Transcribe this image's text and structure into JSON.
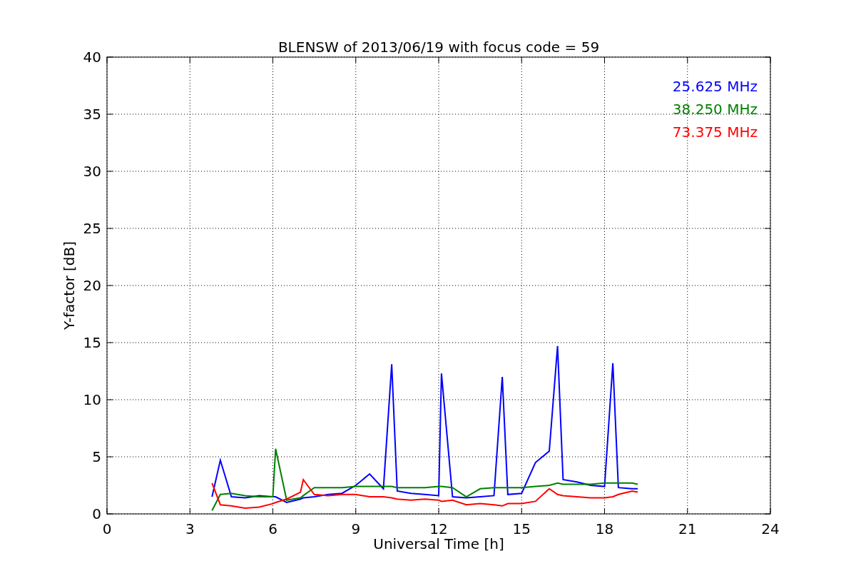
{
  "chart_data": {
    "type": "line",
    "title": "BLENSW of 2013/06/19 with focus code = 59",
    "xlabel": "Universal Time [h]",
    "ylabel": "Y-factor [dB]",
    "x": [
      3.8,
      4.1,
      4.5,
      5,
      5.5,
      6,
      6.1,
      6.5,
      7,
      7.1,
      7.5,
      8,
      8.5,
      9,
      9.5,
      10,
      10.3,
      10.5,
      11,
      11.5,
      12,
      12.1,
      12.5,
      13,
      13.5,
      14,
      14.3,
      14.5,
      15,
      15.5,
      16,
      16.3,
      16.5,
      17,
      17.5,
      18,
      18.3,
      18.5,
      19,
      19.2
    ],
    "series": [
      {
        "name": "25.625 MHz",
        "color": "#0000ff",
        "values": [
          1.5,
          4.7,
          1.5,
          1.4,
          1.6,
          1.5,
          1.5,
          1.0,
          1.3,
          1.4,
          1.5,
          1.7,
          1.8,
          2.5,
          3.5,
          2.2,
          13.1,
          2.0,
          1.8,
          1.7,
          1.6,
          12.3,
          1.5,
          1.4,
          1.5,
          1.6,
          12.0,
          1.7,
          1.8,
          4.5,
          5.5,
          14.7,
          3.0,
          2.8,
          2.5,
          2.4,
          13.2,
          2.3,
          2.2,
          2.2
        ]
      },
      {
        "name": "38.250 MHz",
        "color": "#008000",
        "values": [
          0.3,
          1.7,
          1.8,
          1.6,
          1.5,
          1.5,
          5.7,
          1.2,
          1.4,
          1.6,
          2.3,
          2.3,
          2.3,
          2.4,
          2.4,
          2.4,
          2.4,
          2.3,
          2.3,
          2.3,
          2.4,
          2.4,
          2.3,
          1.5,
          2.2,
          2.3,
          2.3,
          2.3,
          2.3,
          2.4,
          2.5,
          2.7,
          2.6,
          2.6,
          2.6,
          2.7,
          2.7,
          2.7,
          2.7,
          2.6
        ]
      },
      {
        "name": "73.375 MHz",
        "color": "#ff0000",
        "values": [
          2.7,
          0.8,
          0.7,
          0.5,
          0.6,
          0.9,
          1.0,
          1.3,
          1.9,
          3.0,
          1.7,
          1.6,
          1.7,
          1.7,
          1.5,
          1.5,
          1.4,
          1.3,
          1.2,
          1.3,
          1.2,
          1.1,
          1.2,
          0.8,
          0.9,
          0.8,
          0.7,
          0.9,
          0.9,
          1.1,
          2.2,
          1.7,
          1.6,
          1.5,
          1.4,
          1.4,
          1.5,
          1.7,
          2.0,
          1.9
        ]
      }
    ],
    "grid": true,
    "xlim": [
      0,
      24
    ],
    "ylim": [
      0,
      40
    ],
    "xticks": [
      0,
      3,
      6,
      9,
      12,
      15,
      18,
      21,
      24
    ],
    "yticks": [
      0,
      5,
      10,
      15,
      20,
      25,
      30,
      35,
      40
    ]
  }
}
